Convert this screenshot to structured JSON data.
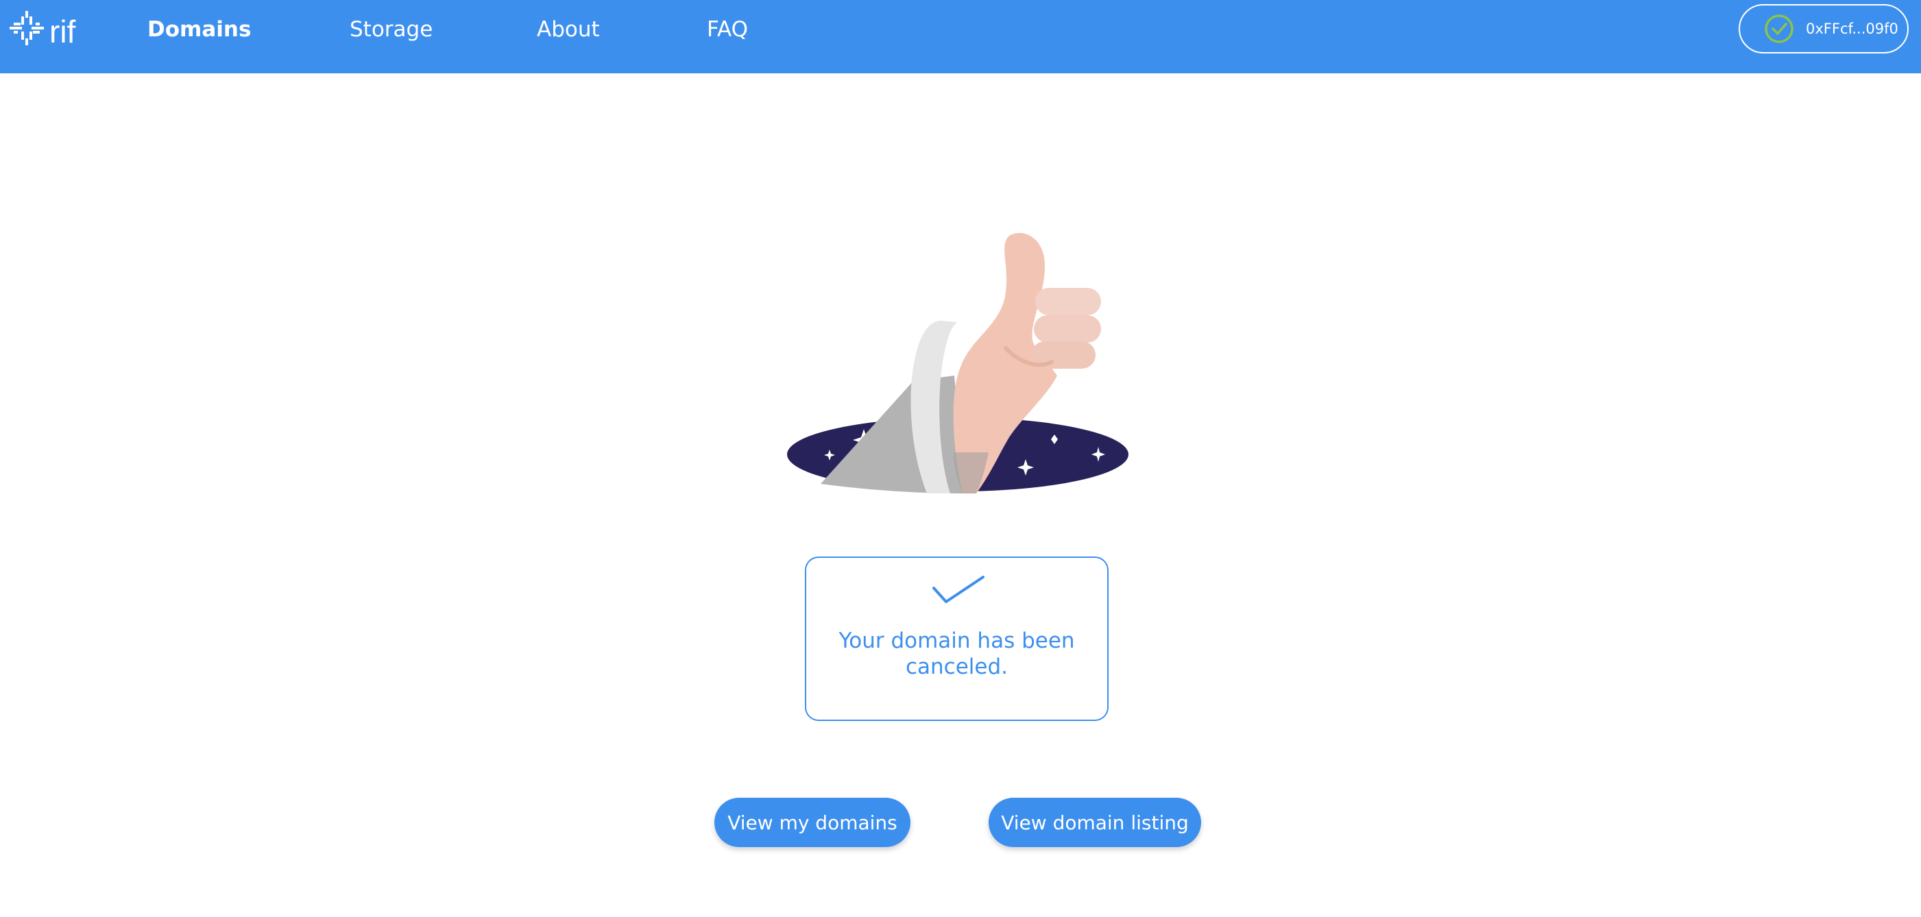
{
  "header": {
    "logo_text": "rif",
    "nav": [
      {
        "label": "Domains",
        "active": true
      },
      {
        "label": "Storage",
        "active": false
      },
      {
        "label": "About",
        "active": false
      },
      {
        "label": "FAQ",
        "active": false
      }
    ],
    "wallet": {
      "address": "0xFFcf...09f0",
      "status_icon": "check-circle-icon"
    }
  },
  "main": {
    "illustration": "thumbs-up-hand-from-portal",
    "message": "Your domain has been canceled.",
    "buttons": {
      "view_my_domains": "View my domains",
      "view_domain_listing": "View domain listing"
    }
  },
  "colors": {
    "brand_blue": "#3d8fee",
    "portal_navy": "#27235a",
    "skin": "#f2c4b4",
    "sleeve_gray": "#b3b3b3",
    "cuff_light": "#e6e6e6",
    "wallet_check": "#8bc34a"
  }
}
